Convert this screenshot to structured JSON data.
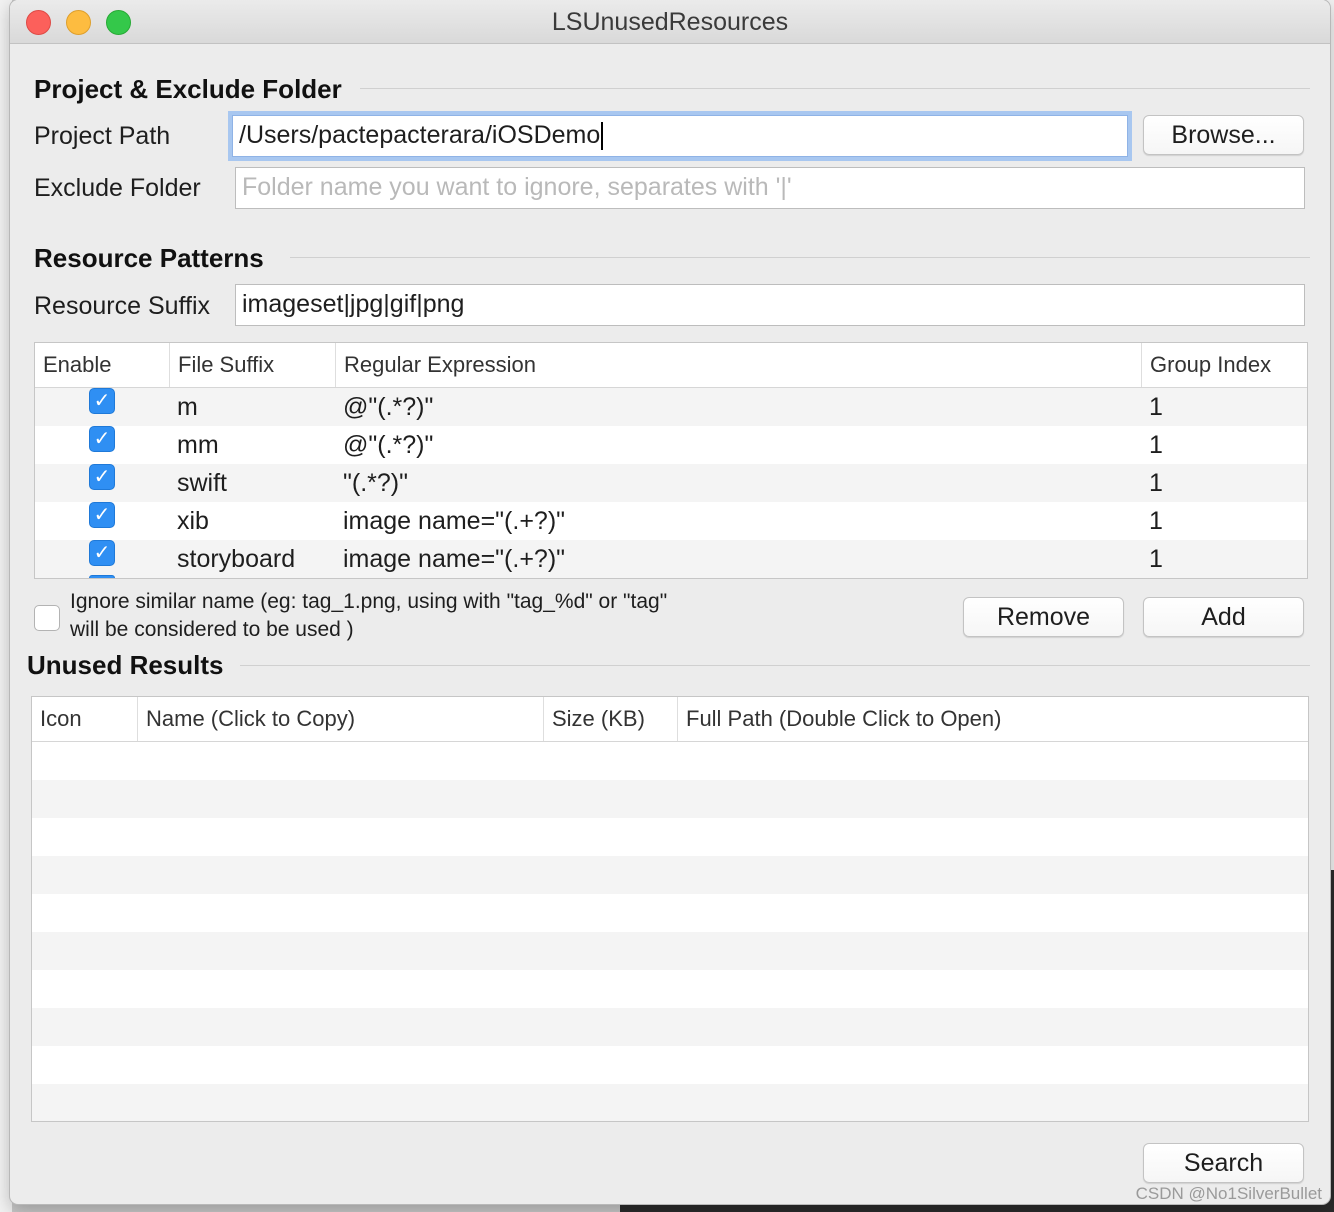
{
  "window": {
    "title": "LSUnusedResources"
  },
  "project_section": {
    "title": "Project & Exclude Folder",
    "project_path_label": "Project Path",
    "project_path_value": "/Users/pactepacterara/iOSDemo",
    "browse_label": "Browse...",
    "exclude_label": "Exclude Folder",
    "exclude_placeholder": "Folder name you want to ignore, separates with '|'"
  },
  "resource_section": {
    "title": "Resource Patterns",
    "suffix_label": "Resource Suffix",
    "suffix_value": "imageset|jpg|gif|png",
    "columns": [
      "Enable",
      "File Suffix",
      "Regular Expression",
      "Group Index"
    ],
    "rows": [
      {
        "enabled": true,
        "suffix": "m",
        "regex": "@\"(.*?)\"",
        "group": "1"
      },
      {
        "enabled": true,
        "suffix": "mm",
        "regex": "@\"(.*?)\"",
        "group": "1"
      },
      {
        "enabled": true,
        "suffix": "swift",
        "regex": "\"(.*?)\"",
        "group": "1"
      },
      {
        "enabled": true,
        "suffix": "xib",
        "regex": "image name=\"(.+?)\"",
        "group": "1"
      },
      {
        "enabled": true,
        "suffix": "storyboard",
        "regex": "image name=\"(.+?)\"",
        "group": "1"
      }
    ],
    "ignore_line1": "Ignore similar name (eg: tag_1.png, using with \"tag_%d\" or \"tag\"",
    "ignore_line2": "will be considered to be used )",
    "ignore_checked": false,
    "remove_label": "Remove",
    "add_label": "Add"
  },
  "results_section": {
    "title": "Unused Results",
    "columns": [
      "Icon",
      "Name (Click to Copy)",
      "Size (KB)",
      "Full Path (Double Click to Open)"
    ],
    "rows": [],
    "search_label": "Search"
  },
  "watermark": "CSDN @No1SilverBullet",
  "colors": {
    "accent": "#2f8ff3",
    "focus_ring": "#a8c7f0",
    "close": "#fc605b",
    "minimize": "#fdbc40",
    "zoom": "#34c84a"
  }
}
